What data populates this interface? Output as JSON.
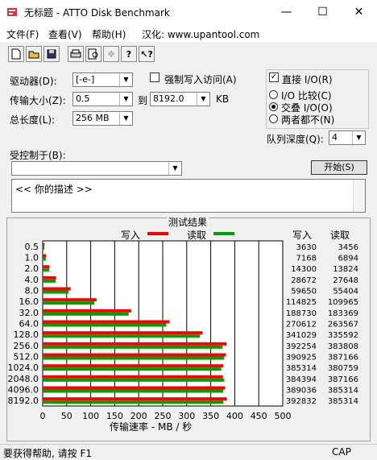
{
  "window": {
    "title": "无标题 - ATTO Disk Benchmark",
    "min": "—",
    "max": "☐",
    "close": "✕"
  },
  "menu": [
    "文件(F)",
    "查看(V)",
    "帮助(H)",
    "汉化: www.upantool.com"
  ],
  "toolbar_icons": [
    "new-icon",
    "open-icon",
    "save-icon",
    "print-icon",
    "print-preview-icon",
    "move-icon",
    "help-icon",
    "context-help-icon"
  ],
  "form": {
    "drive_label": "驱动器(D):",
    "drive_value": "[-e-]",
    "transfer_label": "传输大小(Z):",
    "transfer_from": "0.5",
    "to_label": "到",
    "transfer_to": "8192.0",
    "unit": "KB",
    "length_label": "总长度(L):",
    "length_value": "256 MB",
    "force_write_label": "强制写入访问(A)",
    "direct_io_label": "直接 I/O(R)",
    "radio_compare": "I/O 比较(C)",
    "radio_overlap": "交叠 I/O(O)",
    "radio_neither": "两者都不(N)",
    "queue_label": "队列深度(Q):",
    "queue_value": "4",
    "controlled_label": "受控制于(B):",
    "controlled_value": "",
    "start_button": "开始(S)",
    "description": "<<  你的描述  >>"
  },
  "results": {
    "title": "测试结果",
    "write_legend": "写入",
    "read_legend": "读取",
    "col_write": "写入",
    "col_read": "读取",
    "xlabel": "传输速率 - MB / 秒",
    "write_color": "#ff0000",
    "read_color": "#00a000"
  },
  "chart_data": {
    "type": "bar",
    "orientation": "horizontal",
    "title": "测试结果",
    "xlabel": "传输速率 - MB / 秒",
    "xlim": [
      0,
      500
    ],
    "xticks": [
      0,
      50,
      100,
      150,
      200,
      250,
      300,
      350,
      400,
      450,
      500
    ],
    "categories": [
      "0.5",
      "1.0",
      "2.0",
      "4.0",
      "8.0",
      "16.0",
      "32.0",
      "64.0",
      "128.0",
      "256.0",
      "512.0",
      "1024.0",
      "2048.0",
      "4096.0",
      "8192.0"
    ],
    "series": [
      {
        "name": "写入",
        "color": "#ff0000",
        "values_kbs": [
          3630,
          7168,
          14300,
          28672,
          59650,
          114825,
          188730,
          270612,
          341029,
          392254,
          390925,
          385314,
          384394,
          389036,
          392832
        ]
      },
      {
        "name": "读取",
        "color": "#00a000",
        "values_kbs": [
          3456,
          6894,
          13824,
          27648,
          55404,
          109965,
          183369,
          263567,
          335592,
          383808,
          387166,
          380759,
          387166,
          385314,
          385314
        ]
      }
    ],
    "grid": true,
    "legend": "top"
  },
  "status": {
    "text": "要获得帮助, 请按 F1",
    "cap": "CAP"
  }
}
